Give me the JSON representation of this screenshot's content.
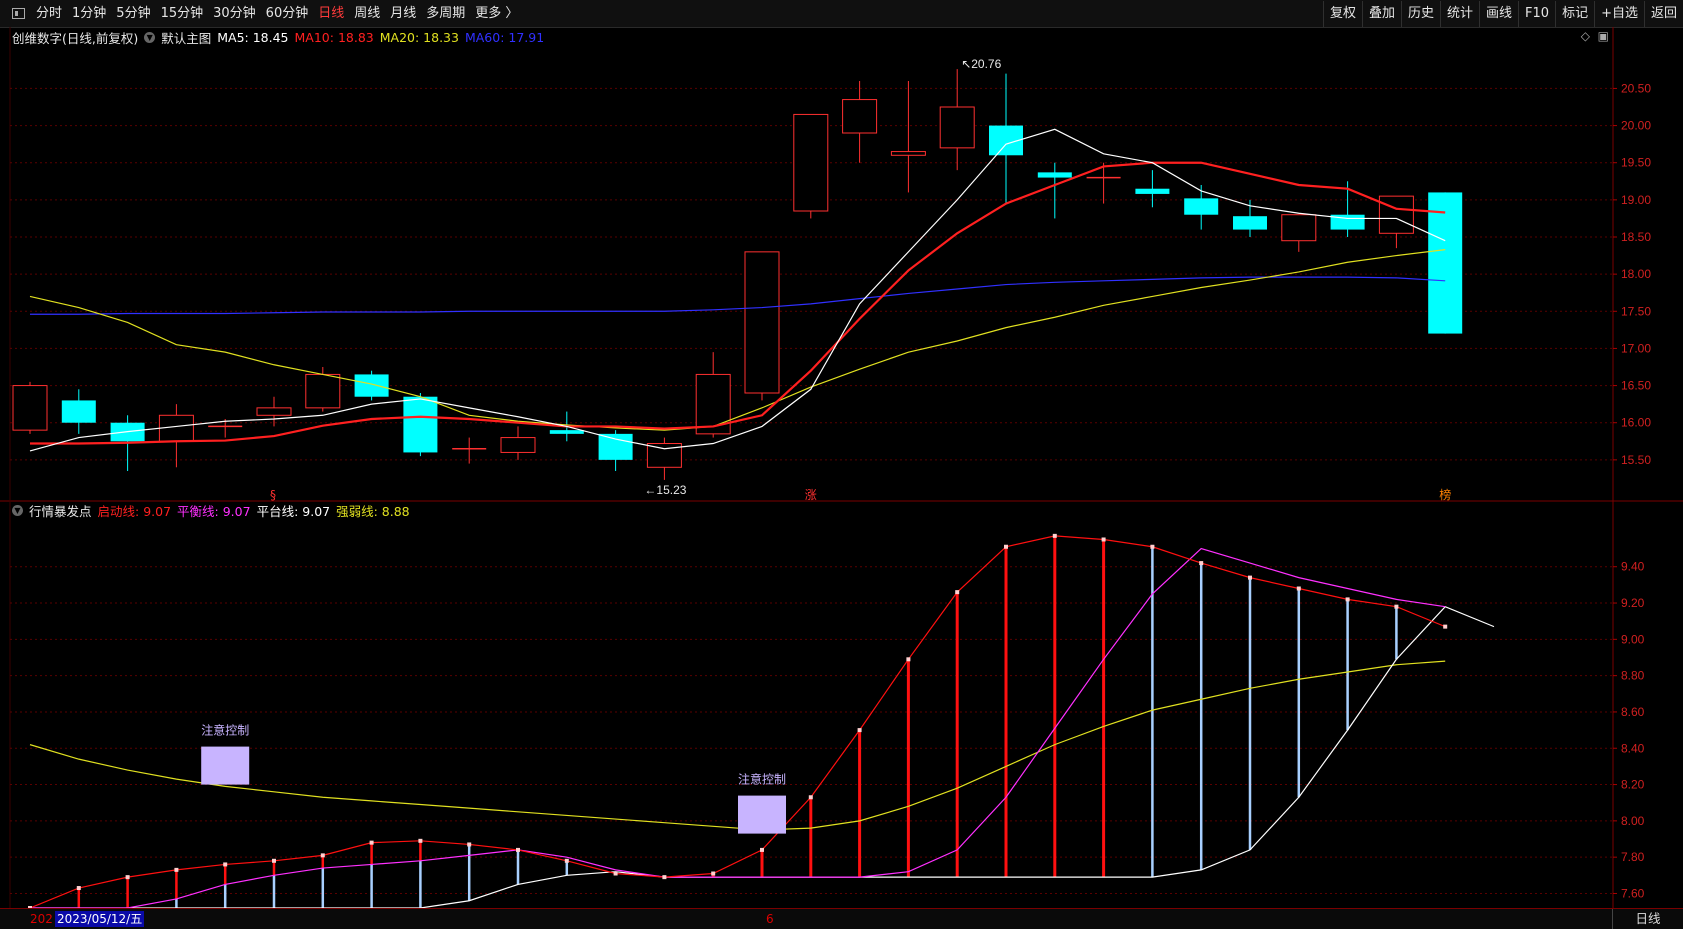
{
  "toolbar": {
    "left": [
      "分时",
      "1分钟",
      "5分钟",
      "15分钟",
      "30分钟",
      "60分钟",
      "日线",
      "周线",
      "月线",
      "多周期",
      "更多 〉"
    ],
    "active": "日线",
    "right": [
      "复权",
      "叠加",
      "历史",
      "统计",
      "画线",
      "F10",
      "标记",
      "+自选",
      "返回"
    ]
  },
  "main_legend": {
    "title": "创维数字(日线,前复权)",
    "template": "默认主图",
    "ma5": "MA5: 18.45",
    "ma10": "MA10: 18.83",
    "ma20": "MA20: 18.33",
    "ma60": "MA60: 17.91",
    "colors": {
      "ma5": "#ffffff",
      "ma10": "#ff2020",
      "ma20": "#e0e020",
      "ma60": "#3030ff",
      "up": "#ff3030",
      "down": "#00ffff"
    }
  },
  "sub_legend": {
    "title": "行情暴发点",
    "qidong": "启动线: 9.07",
    "pingheng": "平衡线: 9.07",
    "pingtai": "平台线: 9.07",
    "qiangruo": "强弱线: 8.88"
  },
  "status_bar": {
    "prefix": "202",
    "date": "2023/05/12/五",
    "marker": "6",
    "period": "日线"
  },
  "chart_data": {
    "type": "candlestick",
    "main": {
      "yticks": [
        "20.50",
        "20.00",
        "19.50",
        "19.00",
        "18.50",
        "18.00",
        "17.50",
        "17.00",
        "16.50",
        "16.00",
        "15.50"
      ],
      "ylim": [
        15.0,
        20.95
      ],
      "max_label": "20.76",
      "min_label": "15.23",
      "candles": [
        {
          "o": 15.9,
          "c": 16.5,
          "h": 16.55,
          "l": 15.85
        },
        {
          "o": 16.3,
          "c": 16.0,
          "h": 16.45,
          "l": 15.85
        },
        {
          "o": 16.0,
          "c": 15.75,
          "h": 16.1,
          "l": 15.35
        },
        {
          "o": 15.75,
          "c": 16.1,
          "h": 16.25,
          "l": 15.4
        },
        {
          "o": 15.95,
          "c": 15.95,
          "h": 16.05,
          "l": 15.8
        },
        {
          "o": 16.1,
          "c": 16.2,
          "h": 16.35,
          "l": 15.95
        },
        {
          "o": 16.2,
          "c": 16.65,
          "h": 16.75,
          "l": 16.15
        },
        {
          "o": 16.65,
          "c": 16.35,
          "h": 16.7,
          "l": 16.3
        },
        {
          "o": 16.35,
          "c": 15.6,
          "h": 16.4,
          "l": 15.55
        },
        {
          "o": 15.65,
          "c": 15.65,
          "h": 15.8,
          "l": 15.45
        },
        {
          "o": 15.6,
          "c": 15.8,
          "h": 15.95,
          "l": 15.5
        },
        {
          "o": 15.9,
          "c": 15.85,
          "h": 16.15,
          "l": 15.75
        },
        {
          "o": 15.85,
          "c": 15.5,
          "h": 15.9,
          "l": 15.35
        },
        {
          "o": 15.4,
          "c": 15.72,
          "h": 15.8,
          "l": 15.23
        },
        {
          "o": 15.85,
          "c": 16.65,
          "h": 16.95,
          "l": 15.8
        },
        {
          "o": 16.4,
          "c": 18.3,
          "h": 18.3,
          "l": 16.3
        },
        {
          "o": 18.85,
          "c": 20.15,
          "h": 20.15,
          "l": 18.75
        },
        {
          "o": 19.9,
          "c": 20.35,
          "h": 20.6,
          "l": 19.5
        },
        {
          "o": 19.6,
          "c": 19.65,
          "h": 20.6,
          "l": 19.1
        },
        {
          "o": 19.7,
          "c": 20.25,
          "h": 20.76,
          "l": 19.4
        },
        {
          "o": 20.0,
          "c": 19.6,
          "h": 20.7,
          "l": 18.95
        },
        {
          "o": 19.37,
          "c": 19.3,
          "h": 19.5,
          "l": 18.75
        },
        {
          "o": 19.3,
          "c": 19.3,
          "h": 19.5,
          "l": 18.95
        },
        {
          "o": 19.15,
          "c": 19.08,
          "h": 19.4,
          "l": 18.9
        },
        {
          "o": 19.02,
          "c": 18.8,
          "h": 19.2,
          "l": 18.6
        },
        {
          "o": 18.78,
          "c": 18.6,
          "h": 19.0,
          "l": 18.5
        },
        {
          "o": 18.45,
          "c": 18.8,
          "h": 18.8,
          "l": 18.3
        },
        {
          "o": 18.8,
          "c": 18.6,
          "h": 19.25,
          "l": 18.5
        },
        {
          "o": 18.55,
          "c": 19.05,
          "h": 19.05,
          "l": 18.35
        },
        {
          "o": 19.1,
          "c": 17.2,
          "h": 19.1,
          "l": 17.2
        }
      ],
      "ma5": [
        15.62,
        15.8,
        15.88,
        15.95,
        16.02,
        16.05,
        16.1,
        16.25,
        16.32,
        16.2,
        16.08,
        15.95,
        15.78,
        15.65,
        15.72,
        15.95,
        16.45,
        17.6,
        18.3,
        19.0,
        19.75,
        19.95,
        19.62,
        19.5,
        19.12,
        18.92,
        18.82,
        18.75,
        18.75,
        18.45
      ],
      "ma10": [
        15.72,
        15.72,
        15.73,
        15.75,
        15.76,
        15.82,
        15.96,
        16.05,
        16.08,
        16.05,
        16.0,
        15.95,
        15.95,
        15.92,
        15.95,
        16.1,
        16.7,
        17.4,
        18.05,
        18.55,
        18.95,
        19.2,
        19.45,
        19.5,
        19.5,
        19.35,
        19.2,
        19.15,
        18.88,
        18.83
      ],
      "ma20": [
        17.7,
        17.55,
        17.35,
        17.05,
        16.95,
        16.78,
        16.65,
        16.52,
        16.35,
        16.1,
        16.02,
        15.97,
        15.93,
        15.9,
        15.95,
        16.2,
        16.48,
        16.72,
        16.95,
        17.1,
        17.28,
        17.42,
        17.58,
        17.7,
        17.82,
        17.92,
        18.03,
        18.16,
        18.25,
        18.33
      ],
      "ma60": [
        17.46,
        17.46,
        17.47,
        17.47,
        17.47,
        17.48,
        17.49,
        17.49,
        17.49,
        17.5,
        17.5,
        17.5,
        17.5,
        17.5,
        17.52,
        17.55,
        17.6,
        17.67,
        17.74,
        17.8,
        17.86,
        17.89,
        17.91,
        17.93,
        17.95,
        17.96,
        17.96,
        17.96,
        17.95,
        17.91
      ],
      "signals": [
        {
          "i": 5,
          "text": "§"
        },
        {
          "i": 16,
          "text": "涨"
        },
        {
          "i": 29,
          "text": "榜"
        }
      ]
    },
    "sub": {
      "yticks": [
        "9.40",
        "9.20",
        "9.00",
        "8.80",
        "8.60",
        "8.40",
        "8.20",
        "8.00",
        "7.80",
        "7.60"
      ],
      "ylim": [
        7.52,
        9.74
      ],
      "qidong": [
        7.52,
        7.63,
        7.69,
        7.73,
        7.76,
        7.78,
        7.81,
        7.88,
        7.89,
        7.87,
        7.84,
        7.78,
        7.71,
        7.69,
        7.71,
        7.84,
        8.13,
        8.5,
        8.89,
        9.26,
        9.51,
        9.57,
        9.55,
        9.51,
        9.42,
        9.34,
        9.28,
        9.22,
        9.18,
        9.07
      ],
      "pingheng": [
        7.52,
        7.52,
        7.52,
        7.57,
        7.65,
        7.7,
        7.74,
        7.76,
        7.78,
        7.81,
        7.84,
        7.8,
        7.73,
        7.69,
        7.69,
        7.69,
        7.69,
        7.69,
        7.72,
        7.84,
        8.13,
        8.51,
        8.89,
        9.25,
        9.5,
        9.42,
        9.34,
        9.28,
        9.22,
        9.18
      ],
      "pingtai": [
        7.52,
        7.52,
        7.52,
        7.52,
        7.52,
        7.52,
        7.52,
        7.52,
        7.52,
        7.56,
        7.65,
        7.7,
        7.72,
        7.69,
        7.69,
        7.69,
        7.69,
        7.69,
        7.69,
        7.69,
        7.69,
        7.69,
        7.69,
        7.69,
        7.73,
        7.84,
        8.13,
        8.5,
        8.89,
        9.18,
        9.07
      ],
      "qiangruo": [
        8.42,
        8.34,
        8.28,
        8.23,
        8.19,
        8.16,
        8.13,
        8.11,
        8.09,
        8.07,
        8.05,
        8.03,
        8.01,
        7.99,
        7.97,
        7.95,
        7.96,
        8.0,
        8.08,
        8.18,
        8.3,
        8.42,
        8.52,
        8.61,
        8.67,
        8.73,
        8.78,
        8.82,
        8.86,
        8.88
      ],
      "warnings": [
        {
          "i": 4,
          "text": "注意控制",
          "level": 8.31
        },
        {
          "i": 15,
          "text": "注意控制",
          "level": 8.04
        }
      ]
    }
  }
}
